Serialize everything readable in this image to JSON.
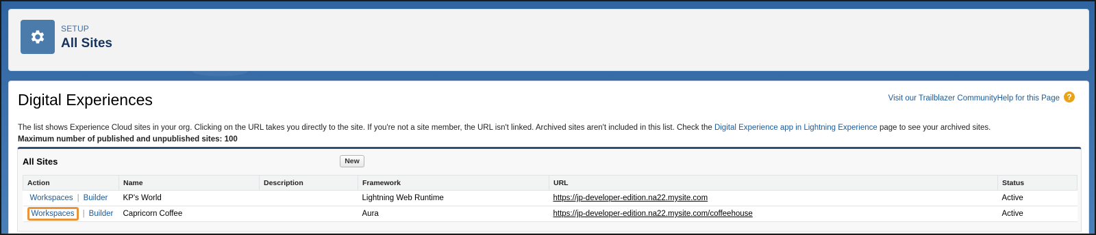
{
  "header": {
    "eyebrow": "SETUP",
    "title": "All Sites",
    "icon": "gear-icon"
  },
  "main": {
    "title": "Digital Experiences",
    "help_link": "Visit our Trailblazer CommunityHelp for this Page",
    "help_icon": "?",
    "description_prefix": "The list shows Experience Cloud sites in your org. Clicking on the URL takes you directly to the site. If you're not a site member, the URL isn't linked. Archived sites aren't included in this list. Check the ",
    "description_link": "Digital Experience app in Lightning Experience",
    "description_suffix": " page to see your archived sites.",
    "max_sites": "Maximum number of published and unpublished sites: 100"
  },
  "list": {
    "title": "All Sites",
    "new_label": "New",
    "columns": [
      "Action",
      "Name",
      "Description",
      "Framework",
      "URL",
      "Status"
    ],
    "rows": [
      {
        "action_workspaces": "Workspaces",
        "action_sep": "|",
        "action_builder": "Builder",
        "name": "KP's World",
        "description": "",
        "framework": "Lightning Web Runtime",
        "url": "https://jp-developer-edition.na22.mysite.com",
        "status": "Active"
      },
      {
        "action_workspaces": "Workspaces",
        "action_sep": "|",
        "action_builder": "Builder",
        "name": "Capricorn Coffee",
        "description": "",
        "framework": "Aura",
        "url": "https://jp-developer-edition.na22.mysite.com/coffeehouse",
        "status": "Active"
      }
    ]
  },
  "colors": {
    "brand_blue": "#4a7bab",
    "link": "#1a5a9a",
    "highlight": "#e8943a"
  }
}
